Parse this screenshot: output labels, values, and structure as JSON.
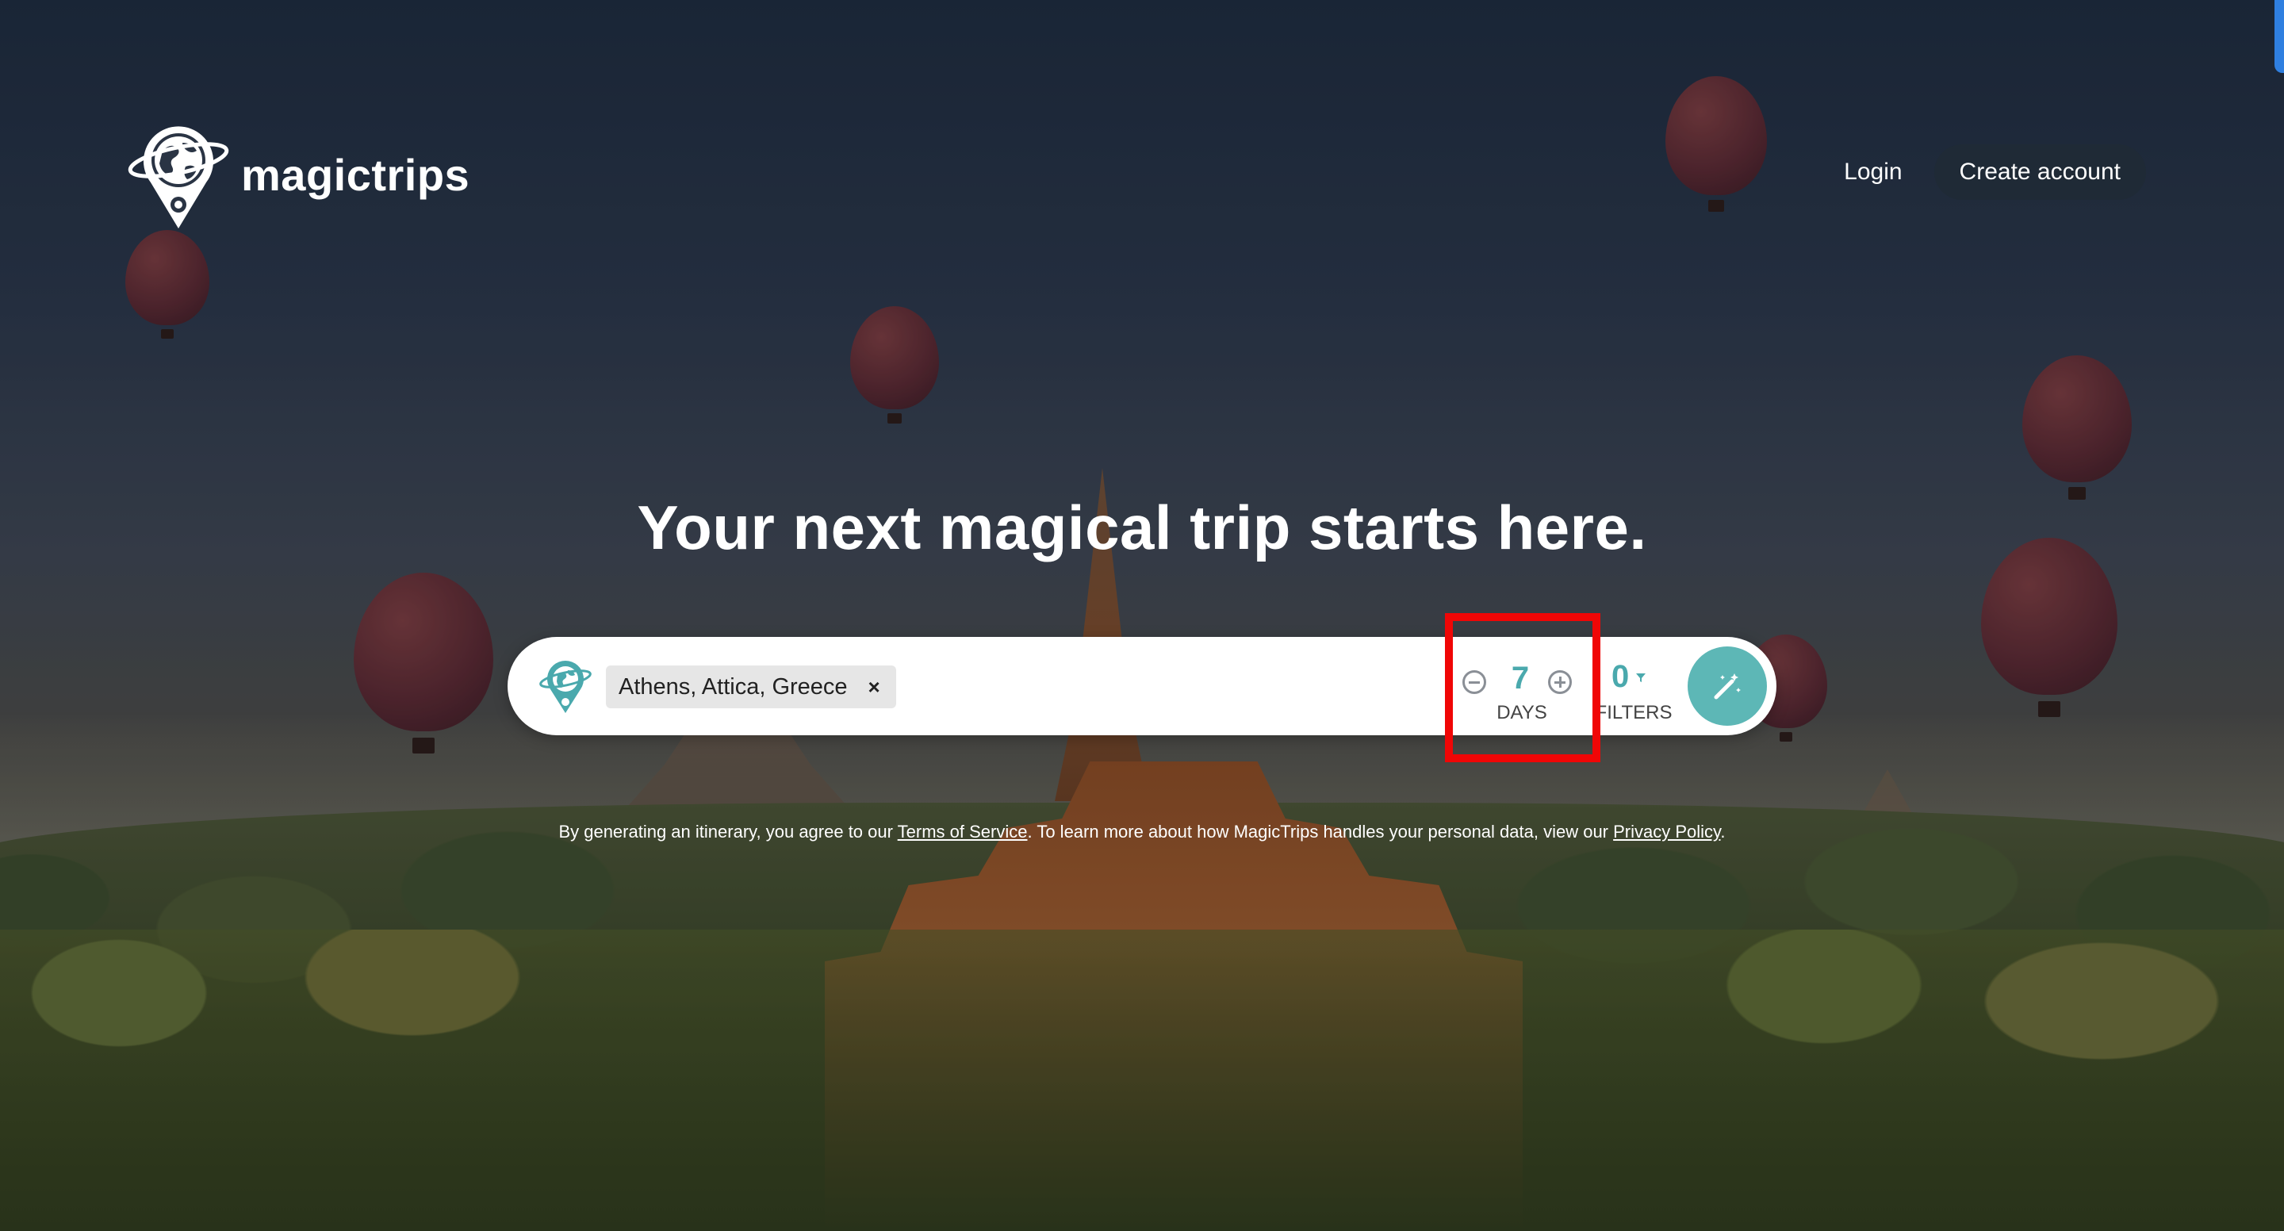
{
  "brand": {
    "name": "magictrips"
  },
  "nav": {
    "login_label": "Login",
    "create_account_label": "Create account"
  },
  "hero": {
    "title": "Your next magical trip starts here."
  },
  "search": {
    "destination_chip": "Athens, Attica, Greece",
    "chip_remove": "×",
    "days_value": "7",
    "days_label": "DAYS",
    "filters_count": "0",
    "filters_label": "FILTERS"
  },
  "legal": {
    "prefix": "By generating an itinerary, you agree to our ",
    "terms_link": "Terms of Service",
    "middle": ". To learn more about how MagicTrips handles your personal data, view our ",
    "privacy_link": "Privacy Policy",
    "suffix": "."
  },
  "colors": {
    "accent": "#5db7b6",
    "accent_text": "#4aa9ad",
    "highlight": "#f00606",
    "nav_button": "#1f2a36"
  },
  "icons": [
    "globe-pin-logo-icon",
    "globe-pin-icon",
    "minus-circle-icon",
    "plus-circle-icon",
    "filter-funnel-icon",
    "magic-wand-icon",
    "close-icon"
  ]
}
